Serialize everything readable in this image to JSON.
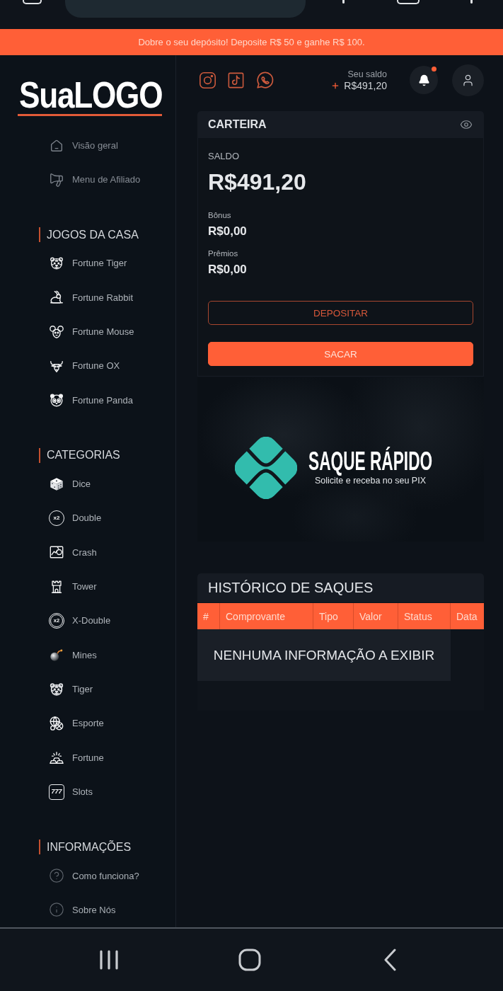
{
  "announcement": {
    "text": "Dobre o seu depósito! Deposite R$ 50 e ganhe R$ 100."
  },
  "sidebar": {
    "logo": "SuaLOGO",
    "menu": [
      {
        "label": "Visão geral"
      },
      {
        "label": "Menu de Afiliado"
      }
    ],
    "sections": [
      {
        "title": "JOGOS DA CASA",
        "items": [
          {
            "label": "Fortune Tiger"
          },
          {
            "label": "Fortune Rabbit"
          },
          {
            "label": "Fortune Mouse"
          },
          {
            "label": "Fortune OX"
          },
          {
            "label": "Fortune Panda"
          }
        ]
      },
      {
        "title": "CATEGORIAS",
        "items": [
          {
            "label": "Dice"
          },
          {
            "label": "Double",
            "icon_text": "x2"
          },
          {
            "label": "Crash"
          },
          {
            "label": "Tower"
          },
          {
            "label": "X-Double",
            "icon_text": "x2"
          },
          {
            "label": "Mines"
          },
          {
            "label": "Tiger"
          },
          {
            "label": "Esporte"
          },
          {
            "label": "Fortune"
          },
          {
            "label": "Slots",
            "icon_text": "777"
          }
        ]
      },
      {
        "title": "INFORMAÇÕES",
        "items": [
          {
            "label": "Como funciona?"
          },
          {
            "label": "Sobre Nós"
          }
        ]
      }
    ]
  },
  "header": {
    "balance_label": "Seu saldo",
    "balance": "R$491,20",
    "notifications": {
      "unread": true
    }
  },
  "wallet": {
    "title": "CARTEIRA",
    "balance_label": "SALDO",
    "balance": "R$491,20",
    "bonus_label": "Bônus",
    "bonus": "R$0,00",
    "prizes_label": "Prêmios",
    "prizes": "R$0,00",
    "buttons": [
      {
        "label": "DEPOSITAR",
        "kind": "outline"
      },
      {
        "label": "SACAR",
        "kind": "filled"
      }
    ]
  },
  "banner": {
    "title": "SAQUE RÁPIDO",
    "subtitle": "Solicite e receba no seu PIX"
  },
  "history": {
    "title": "HISTÓRICO DE SAQUES",
    "columns": [
      "#",
      "Comprovante",
      "Tipo",
      "Valor",
      "Status",
      "Data"
    ],
    "empty_message": "NENHUMA INFORMAÇÃO A EXIBIR"
  }
}
